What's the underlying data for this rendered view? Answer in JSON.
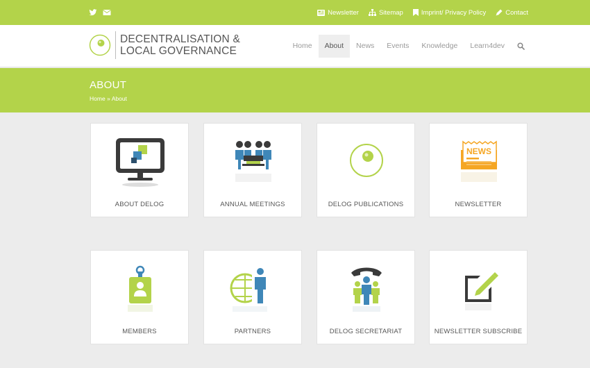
{
  "topbar": {
    "links": [
      {
        "icon": "newspaper-icon",
        "label": "Newsletter"
      },
      {
        "icon": "sitemap-icon",
        "label": "Sitemap"
      },
      {
        "icon": "bookmark-icon",
        "label": "Imprint/ Privacy Policy"
      },
      {
        "icon": "pencil-icon",
        "label": "Contact"
      }
    ]
  },
  "logo": {
    "line1": "DECENTRALISATION &",
    "line2": "LOCAL GOVERNANCE"
  },
  "nav": {
    "items": [
      {
        "label": "Home",
        "active": false
      },
      {
        "label": "About",
        "active": true
      },
      {
        "label": "News",
        "active": false
      },
      {
        "label": "Events",
        "active": false
      },
      {
        "label": "Knowledge",
        "active": false
      },
      {
        "label": "Learn4dev",
        "active": false
      }
    ]
  },
  "banner": {
    "title": "ABOUT",
    "breadcrumb_home": "Home",
    "breadcrumb_sep": "»",
    "breadcrumb_current": "About"
  },
  "tiles": [
    {
      "label": "ABOUT DELOG",
      "icon": "monitor-icon"
    },
    {
      "label": "ANNUAL MEETINGS",
      "icon": "meeting-icon"
    },
    {
      "label": "DELOG PUBLICATIONS",
      "icon": "delog-circle-icon"
    },
    {
      "label": "NEWSLETTER",
      "icon": "news-icon"
    },
    {
      "label": "MEMBERS",
      "icon": "badge-icon"
    },
    {
      "label": "PARTNERS",
      "icon": "globe-person-icon"
    },
    {
      "label": "DELOG SECRETARIAT",
      "icon": "phone-team-icon"
    },
    {
      "label": "NEWSLETTER SUBSCRIBE",
      "icon": "edit-document-icon"
    }
  ],
  "colors": {
    "brand_green": "#b3d34a",
    "icon_blue": "#3f87b8",
    "icon_dark": "#3a3a3a",
    "icon_orange": "#f5a623"
  }
}
